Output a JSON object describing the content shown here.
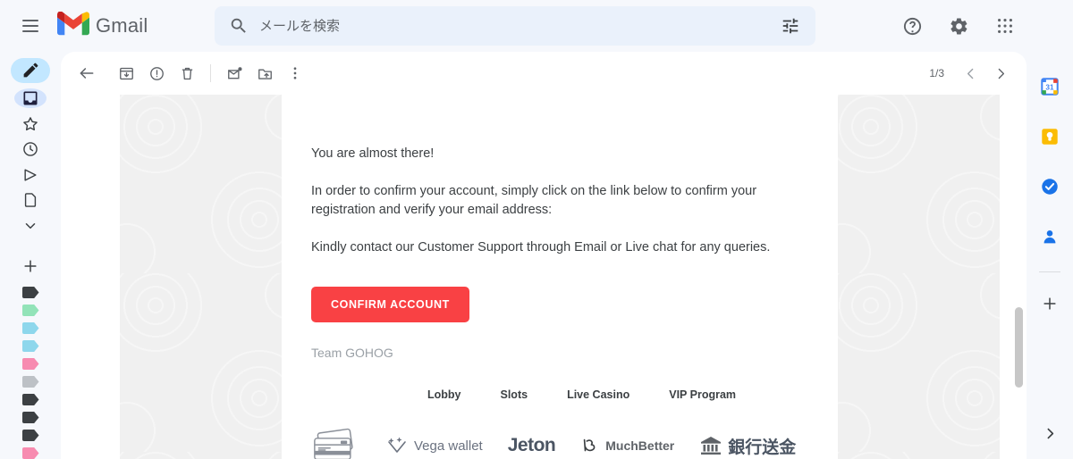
{
  "app": {
    "name": "Gmail"
  },
  "header": {
    "menu_icon": "hamburger-icon",
    "logo_icon": "gmail-logo-icon",
    "brand": "Gmail",
    "search": {
      "placeholder": "メールを検索",
      "value": "",
      "icon": "search-icon",
      "tune_icon": "tune-icon"
    },
    "help_icon": "help-icon",
    "settings_icon": "gear-icon",
    "apps_icon": "apps-grid-icon"
  },
  "left_rail": {
    "compose_label": "Compose",
    "items": [
      {
        "name": "inbox",
        "icon": "inbox-icon",
        "active": true
      },
      {
        "name": "starred",
        "icon": "star-icon",
        "active": false
      },
      {
        "name": "snoozed",
        "icon": "clock-icon",
        "active": false
      },
      {
        "name": "sent",
        "icon": "send-icon",
        "active": false
      },
      {
        "name": "drafts",
        "icon": "file-icon",
        "active": false
      },
      {
        "name": "more",
        "icon": "chevron-down-icon",
        "active": false
      }
    ],
    "add_label": "+",
    "label_colors": [
      "#3c4043",
      "#92e3b8",
      "#8ed7ec",
      "#8ed7ec",
      "#f78bb0",
      "#bdc1c6",
      "#3c4043",
      "#3c4043",
      "#3c4043",
      "#f78bb0"
    ]
  },
  "right_rail": {
    "items": [
      {
        "name": "calendar",
        "icon": "calendar-icon",
        "badge": "31"
      },
      {
        "name": "keep",
        "icon": "keep-bulb-icon"
      },
      {
        "name": "tasks",
        "icon": "tasks-check-icon"
      },
      {
        "name": "contacts",
        "icon": "contacts-person-icon"
      }
    ],
    "add_icon": "plus-icon",
    "expand_icon": "chevron-right-icon"
  },
  "toolbar": {
    "back_icon": "back-arrow-icon",
    "archive_icon": "archive-icon",
    "spam_icon": "report-spam-icon",
    "delete_icon": "trash-icon",
    "unread_icon": "mark-unread-icon",
    "move_icon": "move-to-folder-icon",
    "more_icon": "more-vertical-icon",
    "pager_count": "1/3",
    "prev_icon": "chevron-left-icon",
    "next_icon": "chevron-right-icon"
  },
  "email": {
    "paragraphs": [
      "You are almost there!",
      "In order to confirm your account, simply click on the link below to confirm your registration and verify your email address:",
      "Kindly contact our Customer Support through Email or Live chat for any queries."
    ],
    "cta_label": "CONFIRM ACCOUNT",
    "cta_color": "#f94144",
    "signature": "Team GOHOG",
    "footer_links": [
      "Lobby",
      "Slots",
      "Live Casino",
      "VIP Program"
    ],
    "payment_methods": [
      {
        "name": "credit-cards",
        "label": "",
        "icon": "credit-cards-icon"
      },
      {
        "name": "vega-wallet",
        "label": "Vega wallet",
        "icon": "vega-wallet-icon"
      },
      {
        "name": "jeton",
        "label": "Jeton",
        "icon": "jeton-icon"
      },
      {
        "name": "muchbetter",
        "label": "MuchBetter",
        "icon": "muchbetter-icon"
      },
      {
        "name": "bank-transfer",
        "label": "銀行送金",
        "icon": "bank-icon"
      }
    ]
  }
}
